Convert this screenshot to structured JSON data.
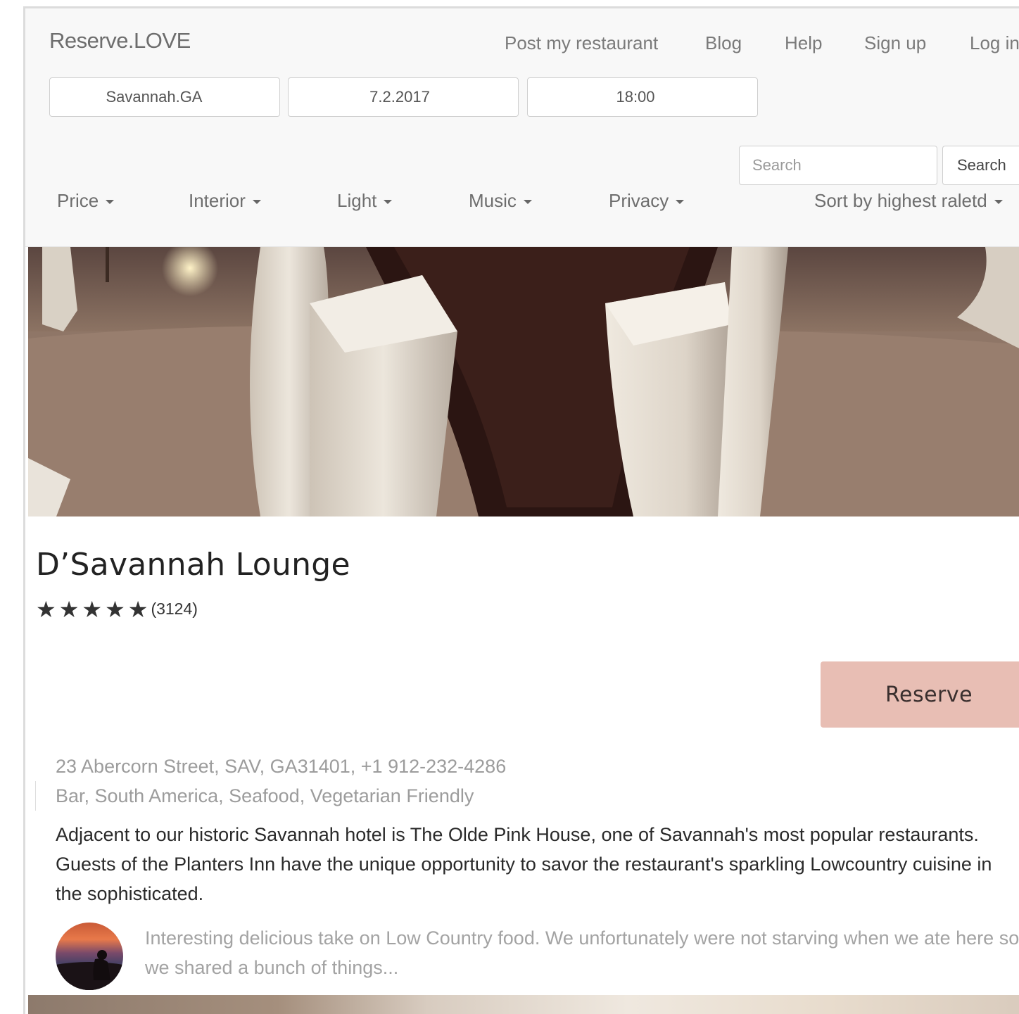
{
  "header": {
    "brand": "Reserve.LOVE",
    "nav": [
      "Post my restaurant",
      "Blog",
      "Help",
      "Sign up",
      "Log in"
    ],
    "location": "Savannah.GA",
    "date": "7.2.2017",
    "time": "18:00",
    "search": {
      "placeholder": "Search",
      "button": "Search"
    },
    "filters": [
      "Price",
      "Interior",
      "Light",
      "Music",
      "Privacy"
    ],
    "sort": "Sort by highest raletd"
  },
  "listing": {
    "name": "D’Savannah Lounge",
    "rating": 5,
    "rating_count": "(3124)",
    "reserve_label": "Reserve",
    "address": "23 Abercorn Street, SAV, GA31401, +1 912-232-4286",
    "tags": "Bar, South America, Seafood, Vegetarian Friendly",
    "description": "Adjacent to our historic Savannah hotel is The Olde Pink House, one of Savannah's most popular restaurants. Guests of the Planters Inn have the unique opportunity to savor the restaurant's sparkling Lowcountry cuisine in the sophisticated.",
    "review": "Interesting delicious take on Low Country food. We unfortunately were not starving when we ate here so we shared a bunch of things..."
  },
  "colors": {
    "reserve_button": "#e8beb4",
    "header_bg": "#f8f8f8"
  }
}
